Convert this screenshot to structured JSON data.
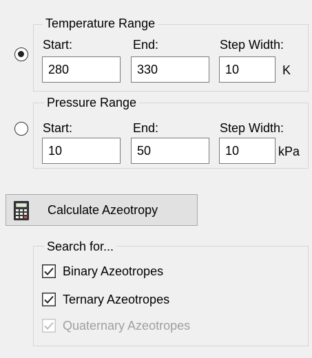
{
  "temperature": {
    "legend": "Temperature Range",
    "start_label": "Start:",
    "end_label": "End:",
    "step_label": "Step Width:",
    "start_value": "280",
    "end_value": "330",
    "step_value": "10",
    "unit": "K",
    "selected": true
  },
  "pressure": {
    "legend": "Pressure Range",
    "start_label": "Start:",
    "end_label": "End:",
    "step_label": "Step Width:",
    "start_value": "10",
    "end_value": "50",
    "step_value": "10",
    "unit": "kPa",
    "selected": false
  },
  "calculate_button": {
    "label": "Calculate Azeotropy",
    "icon": "calculator-icon"
  },
  "search": {
    "legend": "Search for...",
    "options": [
      {
        "label": "Binary Azeotropes",
        "checked": true,
        "enabled": true
      },
      {
        "label": "Ternary Azeotropes",
        "checked": true,
        "enabled": true
      },
      {
        "label": "Quaternary Azeotropes",
        "checked": true,
        "enabled": false
      }
    ]
  }
}
